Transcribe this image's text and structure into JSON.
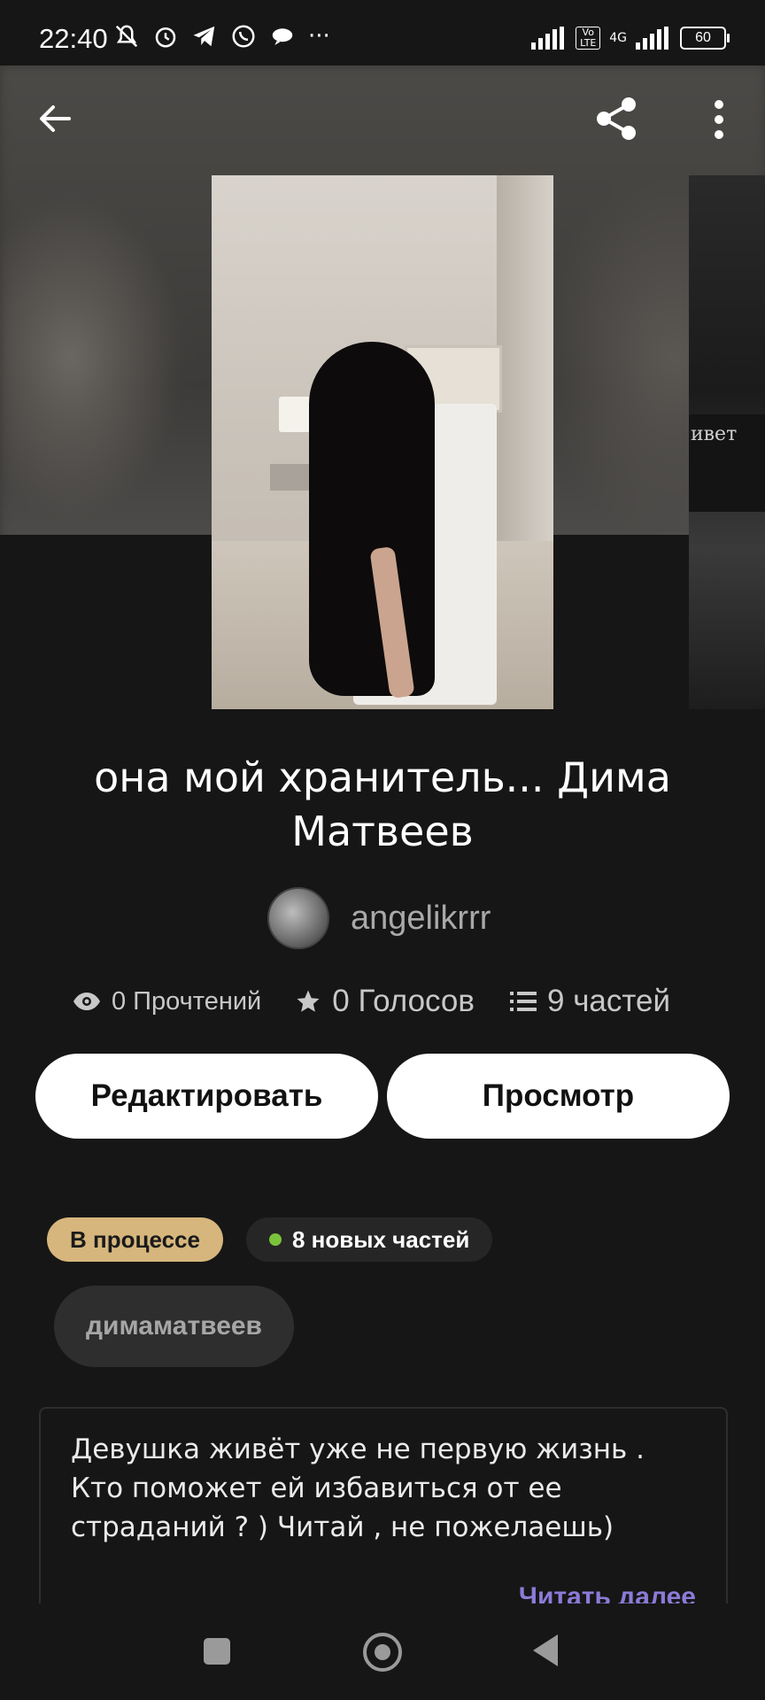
{
  "status_bar": {
    "time": "22:40",
    "network": "4G",
    "volte": "Vo LTE",
    "battery": "60",
    "more": "···"
  },
  "toolbar": {
    "back_icon": "arrow-left-icon",
    "share_icon": "share-icon",
    "more_icon": "more-vertical-icon"
  },
  "story": {
    "title": "она мой хранитель... Дима Матвеев",
    "author": "angelikrrr",
    "stats": {
      "reads": "0 Прочтений",
      "votes": "0 Голосов",
      "parts": "9 частей"
    },
    "buttons": {
      "edit": "Редактировать",
      "view": "Просмотр"
    },
    "status_badge": "В процессе",
    "new_parts_badge": "8 новых частей",
    "tag": "димаматвеев",
    "description": "Девушка живёт уже не первую жизнь . Кто поможет ей избавиться от ее страданий ? ) Читай , не пожелаешь)",
    "read_more": "Читать далее",
    "next_cover_text": "ивет"
  },
  "colors": {
    "background": "#161616",
    "status_badge": "#d6b67c",
    "new_dot": "#7cc33c",
    "read_more": "#8c7bd8"
  }
}
